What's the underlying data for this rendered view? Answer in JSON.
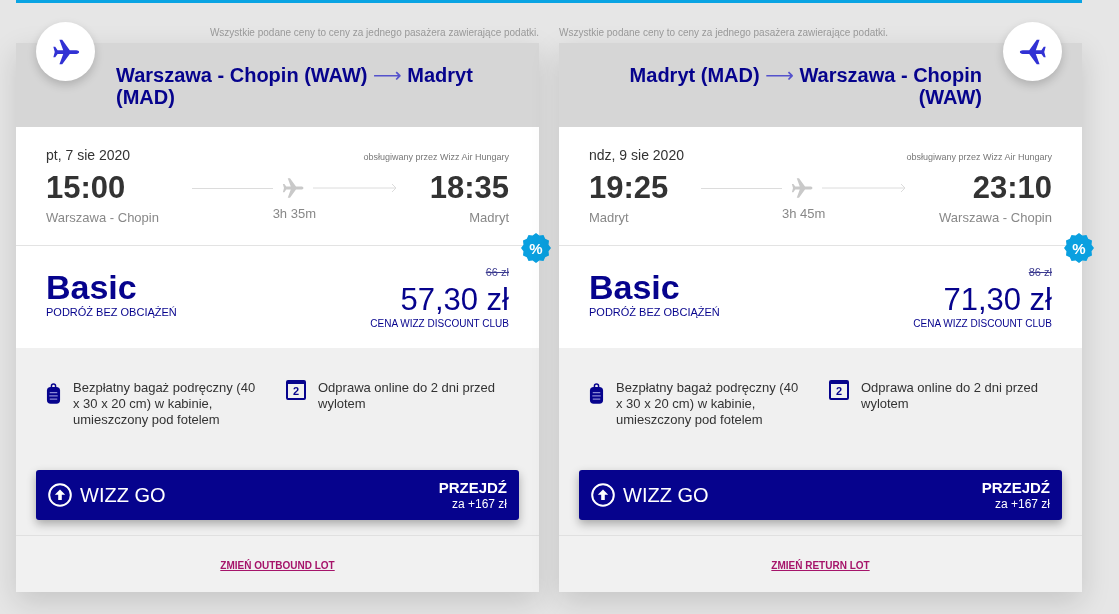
{
  "cards": [
    {
      "kind": "outbound",
      "price_note": "Wszystkie podane ceny to ceny za jednego pasażera zawierające podatki.",
      "route": {
        "from": "Warszawa - Chopin (WAW)",
        "arrow": "⟶",
        "to": "Madryt (MAD)"
      },
      "flight": {
        "date": "pt, 7 sie 2020",
        "operator": "obsługiwany przez Wizz Air Hungary",
        "departure_time": "15:00",
        "departure_city": "Warszawa - Chopin",
        "duration": "3h 35m",
        "arrival_time": "18:35",
        "arrival_city": "Madryt"
      },
      "fare": {
        "name": "Basic",
        "tagline": "PODRÓŻ BEZ OBCIĄŻEŃ",
        "badge": "%",
        "old_price": "66 zł",
        "price": "57,30 zł",
        "price_label": "CENA WIZZ DISCOUNT CLUB"
      },
      "benefits": [
        {
          "kind": "cabin-bag",
          "text": "Bezpłatny bagaż podręczny (40 x 30 x 20 cm) w kabinie, umieszczony pod fotelem"
        },
        {
          "kind": "calendar",
          "icon_label": "2",
          "text": "Odprawa online do 2 dni przed wylotem"
        }
      ],
      "upsell": {
        "label": "WIZZ GO",
        "action": "PRZEJDŹ",
        "price": "za +167 zł"
      },
      "change_link": "ZMIEŃ OUTBOUND LOT"
    },
    {
      "kind": "return",
      "price_note": "Wszystkie podane ceny to ceny za jednego pasażera zawierające podatki.",
      "route": {
        "from": "Madryt (MAD)",
        "arrow": "⟶",
        "to": "Warszawa - Chopin (WAW)"
      },
      "flight": {
        "date": "ndz, 9 sie 2020",
        "operator": "obsługiwany przez Wizz Air Hungary",
        "departure_time": "19:25",
        "departure_city": "Madryt",
        "duration": "3h 45m",
        "arrival_time": "23:10",
        "arrival_city": "Warszawa - Chopin"
      },
      "fare": {
        "name": "Basic",
        "tagline": "PODRÓŻ BEZ OBCIĄŻEŃ",
        "badge": "%",
        "old_price": "86 zł",
        "price": "71,30 zł",
        "price_label": "CENA WIZZ DISCOUNT CLUB"
      },
      "benefits": [
        {
          "kind": "cabin-bag",
          "text": "Bezpłatny bagaż podręczny (40 x 30 x 20 cm) w kabinie, umieszczony pod fotelem"
        },
        {
          "kind": "calendar",
          "icon_label": "2",
          "text": "Odprawa online do 2 dni przed wylotem"
        }
      ],
      "upsell": {
        "label": "WIZZ GO",
        "action": "PRZEJDŹ",
        "price": "za +167 zł"
      },
      "change_link": "ZMIEŃ RETURN LOT"
    }
  ]
}
